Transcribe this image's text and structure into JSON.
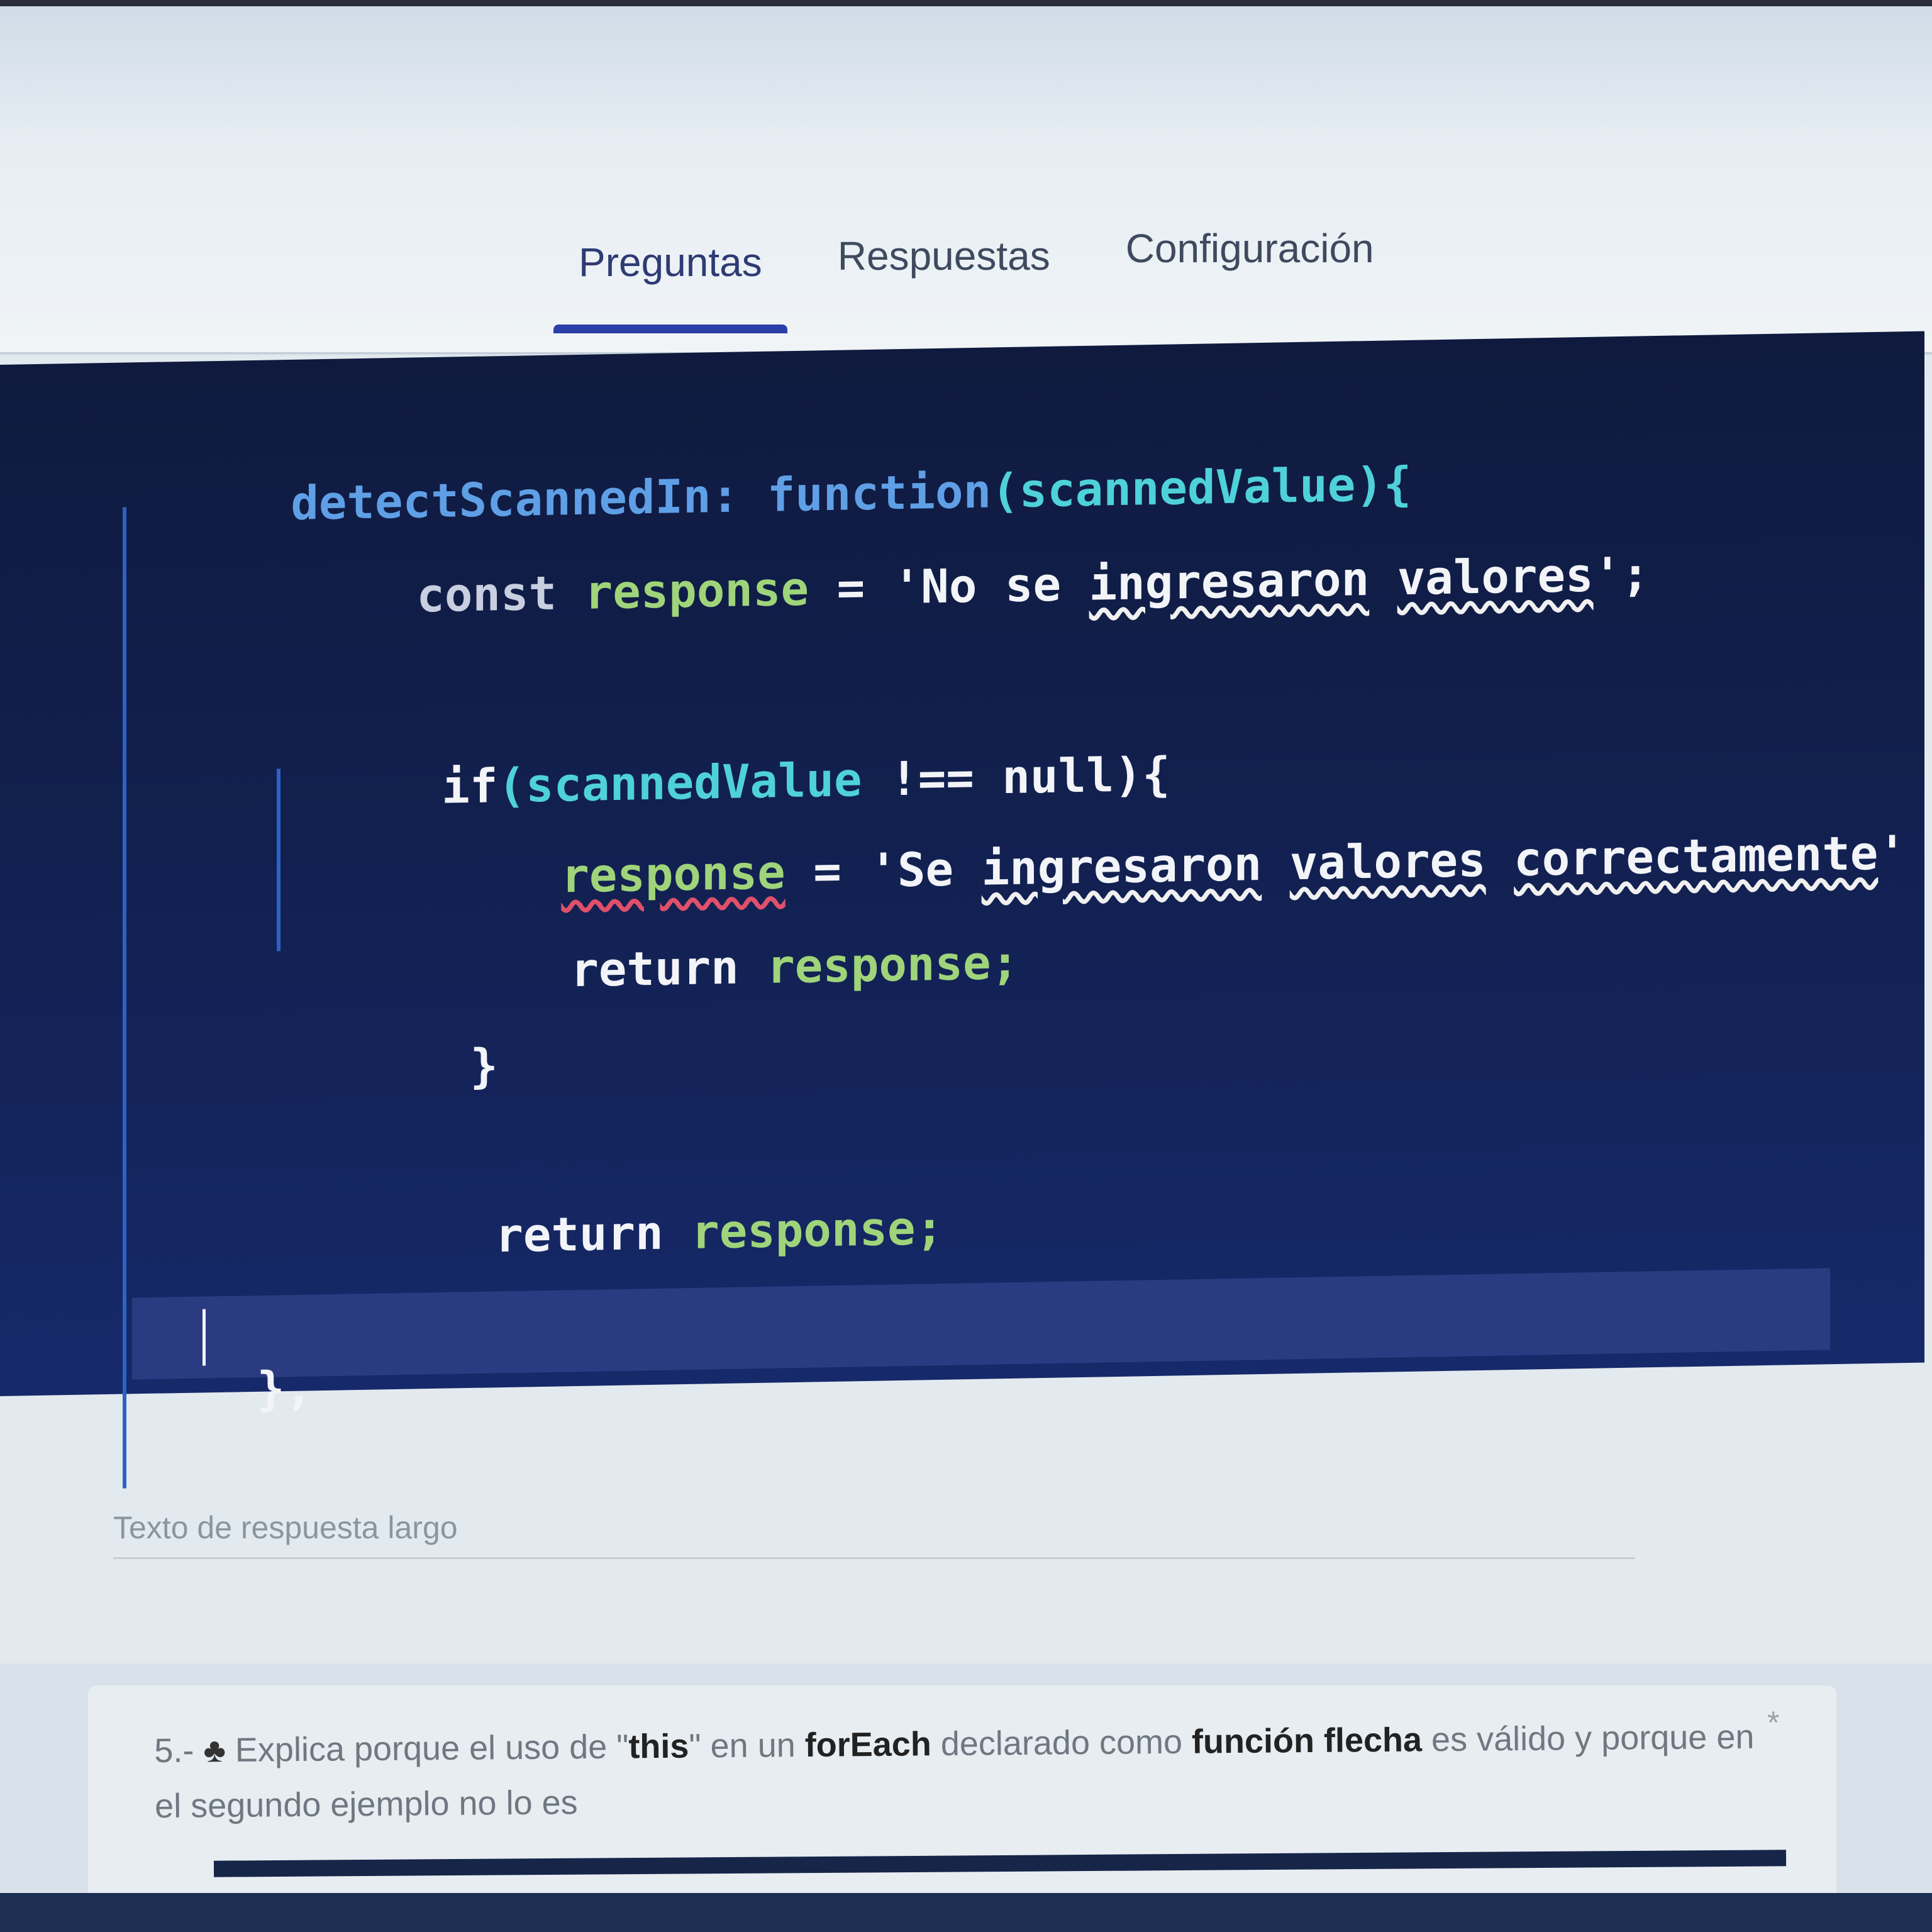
{
  "tabs": [
    {
      "label": "Preguntas",
      "active": true
    },
    {
      "label": "Respuestas",
      "active": false
    },
    {
      "label": "Configuración",
      "active": false
    }
  ],
  "code": {
    "line1": {
      "name": "detectScannedIn:",
      "kw": "function",
      "args": "(scannedValue){"
    },
    "line2": {
      "kw": "const",
      "var": "response",
      "eq": "=",
      "str_start": "'No se",
      "w1": "ingresaron",
      "w2": "valores",
      "str_end": "';"
    },
    "line3": {
      "kw": "if",
      "cond": "(scannedValue",
      "op": "!==",
      "rest": "null){"
    },
    "line4": {
      "var": "response",
      "eq": "=",
      "str_start": "'Se",
      "w1": "ingresaron",
      "w2": "valores",
      "w3": "correctamente",
      "str_end": "'"
    },
    "line5": {
      "kw": "return",
      "var": "response;"
    },
    "line6": {
      "text": "}"
    },
    "line7": {
      "kw": "return",
      "var": "response;"
    },
    "line8": {
      "text": "},"
    },
    "line9": {
      "text": "},"
    }
  },
  "answer": {
    "placeholder": "Texto de respuesta largo"
  },
  "question": {
    "number": "5.-",
    "icon": "club-suit-icon",
    "p1": "Explica porque el uso de \"",
    "b1": "this",
    "p2": "\" en un ",
    "b2": "forEach",
    "p3": " declarado como ",
    "b3": "función flecha",
    "p4": " es válido y porque en el segundo ejemplo no lo es",
    "required_mark": "*"
  }
}
